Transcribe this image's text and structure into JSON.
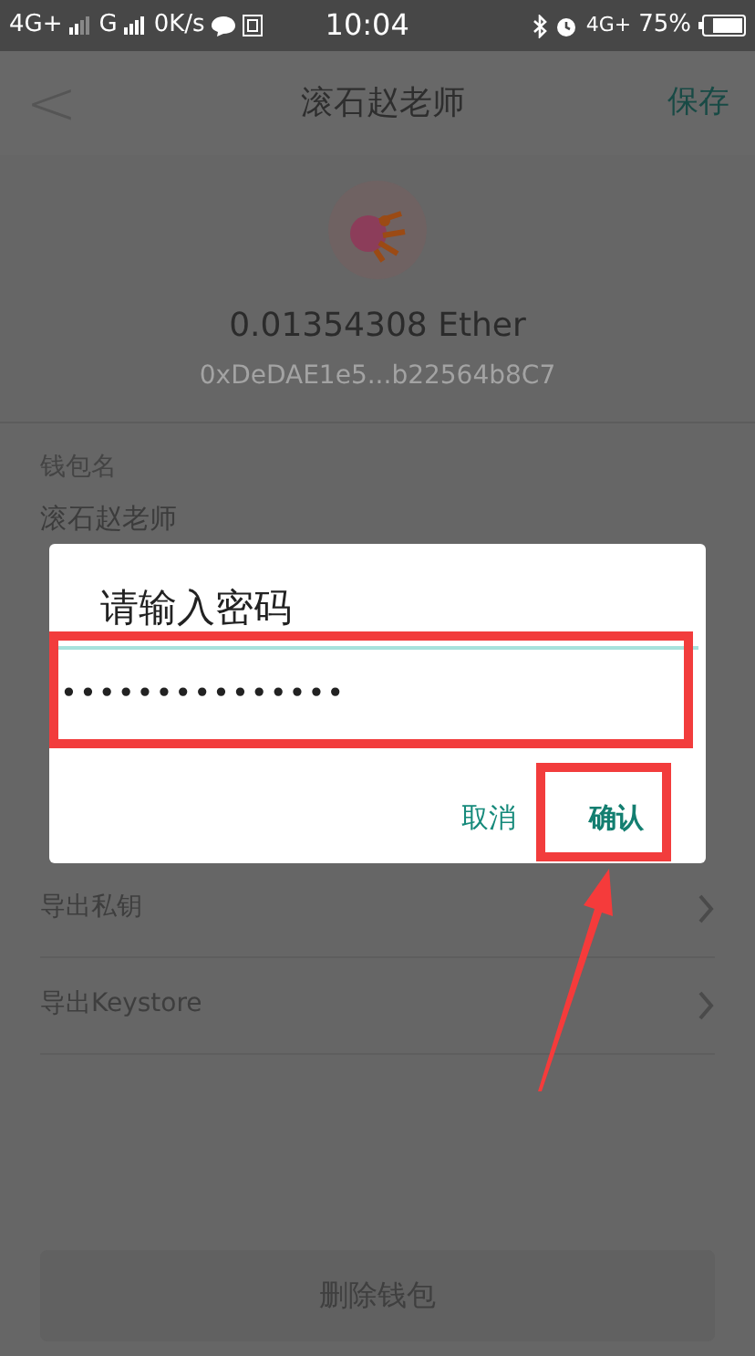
{
  "status_bar": {
    "network_1": "4G+",
    "network_2": "G",
    "speed": "0K/s",
    "time": "10:04",
    "network_3": "4G+",
    "battery": "75%"
  },
  "header": {
    "back": "<",
    "title": "滚石赵老师",
    "action": "保存"
  },
  "wallet": {
    "balance": "0.01354308 Ether",
    "address": "0xDeDAE1e5...b22564b8C7"
  },
  "name_field": {
    "label": "钱包名",
    "value": "滚石赵老师"
  },
  "menu": [
    {
      "label": "导出私钥"
    },
    {
      "label": "导出Keystore"
    }
  ],
  "delete_button": "删除钱包",
  "dialog": {
    "title": "请输入密码",
    "value": "•••••••••••••••",
    "buttons": [
      {
        "label": "取消",
        "kind": "cancel"
      },
      {
        "label": "确认",
        "kind": "confirm"
      }
    ]
  }
}
